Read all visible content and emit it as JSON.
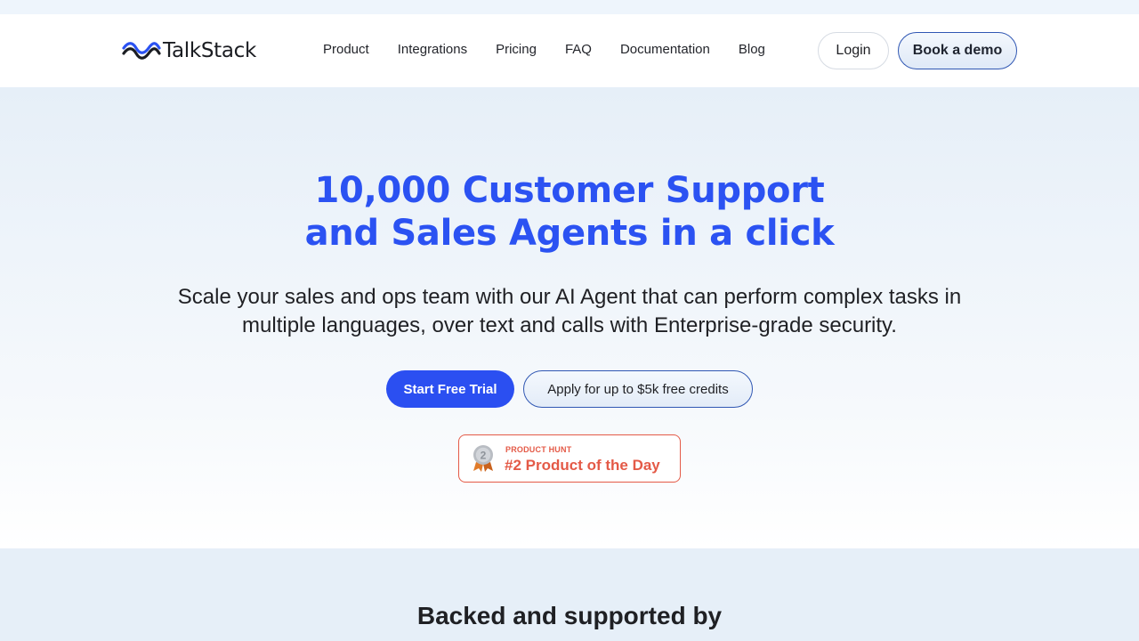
{
  "brand": {
    "name": "TalkStack",
    "accent": "#2b52f2",
    "logo_icon": "wave-icon"
  },
  "nav": {
    "links": [
      "Product",
      "Integrations",
      "Pricing",
      "FAQ",
      "Documentation",
      "Blog"
    ],
    "login_label": "Login",
    "demo_label": "Book a demo"
  },
  "hero": {
    "headline_line1": "10,000 Customer Support",
    "headline_line2": "and Sales Agents in a click",
    "subhead_line1": "Scale your sales and ops team with our AI Agent that can perform complex tasks in",
    "subhead_line2": "multiple languages, over text and calls with Enterprise-grade security.",
    "primary_cta": "Start Free Trial",
    "secondary_cta": "Apply for up to $5k free credits"
  },
  "product_hunt": {
    "label": "PRODUCT HUNT",
    "title": "#2 Product of the Day",
    "rank": "2",
    "icon": "medal-icon",
    "color": "#e45a47"
  },
  "backed": {
    "title": "Backed and supported by"
  }
}
